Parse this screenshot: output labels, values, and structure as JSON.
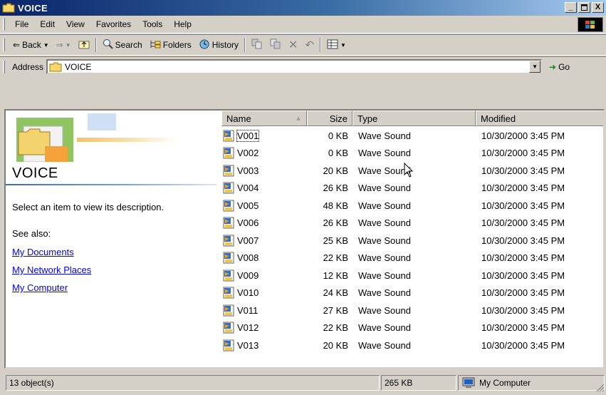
{
  "window": {
    "title": "VOICE"
  },
  "menu": [
    {
      "label": "File",
      "key": "F"
    },
    {
      "label": "Edit",
      "key": "E"
    },
    {
      "label": "View",
      "key": "V"
    },
    {
      "label": "Favorites",
      "key": "a"
    },
    {
      "label": "Tools",
      "key": "T"
    },
    {
      "label": "Help",
      "key": "H"
    }
  ],
  "toolbar": {
    "back": "Back",
    "search": "Search",
    "folders": "Folders",
    "history": "History"
  },
  "address": {
    "label": "Address",
    "value": "VOICE",
    "go": "Go"
  },
  "left_pane": {
    "title": "VOICE",
    "description": "Select an item to view its description.",
    "see_also": "See also:",
    "links": [
      "My Documents",
      "My Network Places",
      "My Computer"
    ]
  },
  "columns": {
    "name": "Name",
    "size": "Size",
    "type": "Type",
    "modified": "Modified"
  },
  "files": [
    {
      "name": "V001",
      "size": "0 KB",
      "type": "Wave Sound",
      "modified": "10/30/2000 3:45 PM"
    },
    {
      "name": "V002",
      "size": "0 KB",
      "type": "Wave Sound",
      "modified": "10/30/2000 3:45 PM"
    },
    {
      "name": "V003",
      "size": "20 KB",
      "type": "Wave Sound",
      "modified": "10/30/2000 3:45 PM"
    },
    {
      "name": "V004",
      "size": "26 KB",
      "type": "Wave Sound",
      "modified": "10/30/2000 3:45 PM"
    },
    {
      "name": "V005",
      "size": "48 KB",
      "type": "Wave Sound",
      "modified": "10/30/2000 3:45 PM"
    },
    {
      "name": "V006",
      "size": "26 KB",
      "type": "Wave Sound",
      "modified": "10/30/2000 3:45 PM"
    },
    {
      "name": "V007",
      "size": "25 KB",
      "type": "Wave Sound",
      "modified": "10/30/2000 3:45 PM"
    },
    {
      "name": "V008",
      "size": "22 KB",
      "type": "Wave Sound",
      "modified": "10/30/2000 3:45 PM"
    },
    {
      "name": "V009",
      "size": "12 KB",
      "type": "Wave Sound",
      "modified": "10/30/2000 3:45 PM"
    },
    {
      "name": "V010",
      "size": "24 KB",
      "type": "Wave Sound",
      "modified": "10/30/2000 3:45 PM"
    },
    {
      "name": "V011",
      "size": "27 KB",
      "type": "Wave Sound",
      "modified": "10/30/2000 3:45 PM"
    },
    {
      "name": "V012",
      "size": "22 KB",
      "type": "Wave Sound",
      "modified": "10/30/2000 3:45 PM"
    },
    {
      "name": "V013",
      "size": "20 KB",
      "type": "Wave Sound",
      "modified": "10/30/2000 3:45 PM"
    }
  ],
  "status": {
    "objects": "13 object(s)",
    "total_size": "265 KB",
    "zone": "My Computer"
  },
  "colors": {
    "titlebar": "#0a246a",
    "face": "#d4d0c8",
    "link": "#0000ff"
  }
}
